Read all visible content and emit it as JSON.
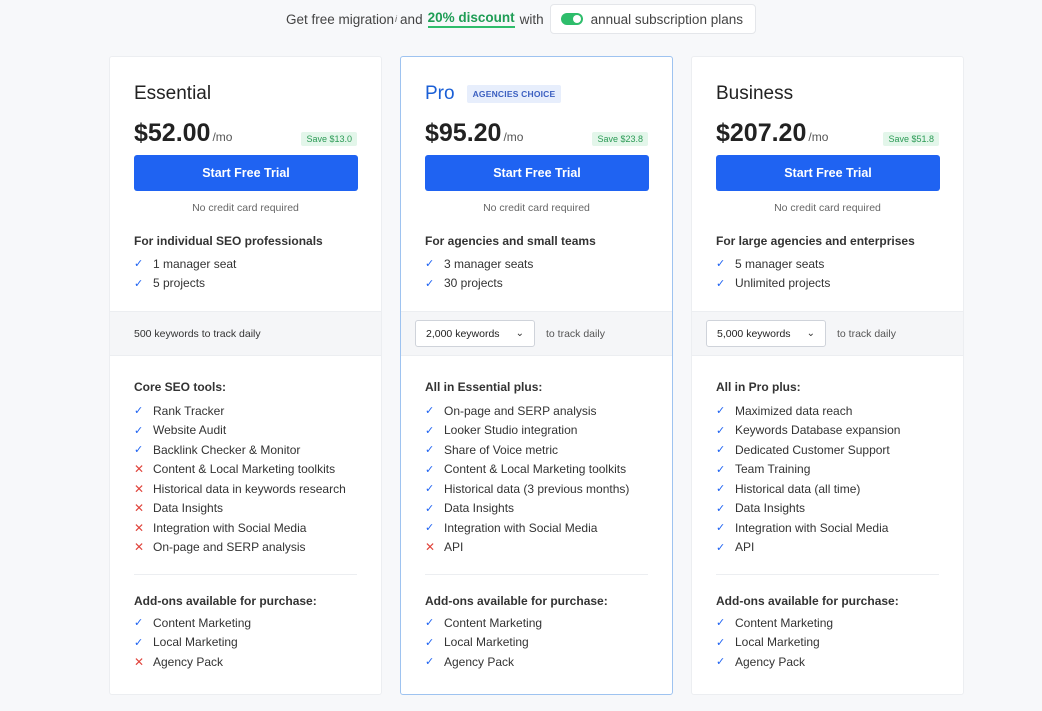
{
  "promo": {
    "text_before": "Get free migration",
    "info_mark": "i",
    "text_and": "and",
    "discount": "20% discount",
    "text_with": "with",
    "toggle_label": "annual subscription plans"
  },
  "colors": {
    "accent": "#1f63f2",
    "check": "#1f63f2",
    "cross": "#e0443c",
    "discount": "#1f9d55"
  },
  "icons": {
    "check": "✓",
    "cross": "✕",
    "chevron": "⌄"
  },
  "plans": [
    {
      "name": "Essential",
      "badge": "",
      "price": "$52.00",
      "period": "/mo",
      "save": "Save $13.0",
      "cta": "Start Free Trial",
      "note": "No credit card required",
      "audience": "For individual SEO professionals",
      "basics": [
        {
          "text": "1 manager seat",
          "included": true
        },
        {
          "text": "5 projects",
          "included": true
        }
      ],
      "keywords_value": "500 keywords to track daily",
      "keywords_suffix": "",
      "features_title": "Core SEO tools:",
      "features": [
        {
          "text": "Rank Tracker",
          "included": true
        },
        {
          "text": "Website Audit",
          "included": true
        },
        {
          "text": "Backlink Checker & Monitor",
          "included": true
        },
        {
          "text": "Content & Local Marketing toolkits",
          "included": false
        },
        {
          "text": "Historical data in keywords research",
          "included": false
        },
        {
          "text": "Data Insights",
          "included": false
        },
        {
          "text": "Integration with Social Media",
          "included": false
        },
        {
          "text": "On-page and SERP analysis",
          "included": false
        }
      ],
      "addons_title": "Add-ons available for purchase:",
      "addons": [
        {
          "text": "Content Marketing",
          "included": true
        },
        {
          "text": "Local Marketing",
          "included": true
        },
        {
          "text": "Agency Pack",
          "included": false
        }
      ]
    },
    {
      "name": "Pro",
      "badge": "AGENCIES CHOICE",
      "price": "$95.20",
      "period": "/mo",
      "save": "Save $23.8",
      "cta": "Start Free Trial",
      "note": "No credit card required",
      "audience": "For agencies and small teams",
      "basics": [
        {
          "text": "3 manager seats",
          "included": true
        },
        {
          "text": "30 projects",
          "included": true
        }
      ],
      "keywords_value": "2,000 keywords",
      "keywords_suffix": "to track daily",
      "features_title": "All in Essential plus:",
      "features": [
        {
          "text": "On-page and SERP analysis",
          "included": true
        },
        {
          "text": "Looker Studio integration",
          "included": true
        },
        {
          "text": "Share of Voice metric",
          "included": true
        },
        {
          "text": "Content & Local Marketing toolkits",
          "included": true
        },
        {
          "text": "Historical data (3 previous months)",
          "included": true
        },
        {
          "text": "Data Insights",
          "included": true
        },
        {
          "text": "Integration with Social Media",
          "included": true
        },
        {
          "text": "API",
          "included": false
        }
      ],
      "addons_title": "Add-ons available for purchase:",
      "addons": [
        {
          "text": "Content Marketing",
          "included": true
        },
        {
          "text": "Local Marketing",
          "included": true
        },
        {
          "text": "Agency Pack",
          "included": true
        }
      ]
    },
    {
      "name": "Business",
      "badge": "",
      "price": "$207.20",
      "period": "/mo",
      "save": "Save $51.8",
      "cta": "Start Free Trial",
      "note": "No credit card required",
      "audience": "For large agencies and enterprises",
      "basics": [
        {
          "text": "5 manager seats",
          "included": true
        },
        {
          "text": "Unlimited projects",
          "included": true
        }
      ],
      "keywords_value": "5,000 keywords",
      "keywords_suffix": "to track daily",
      "features_title": "All in Pro plus:",
      "features": [
        {
          "text": "Maximized data reach",
          "included": true
        },
        {
          "text": "Keywords Database expansion",
          "included": true
        },
        {
          "text": "Dedicated Customer Support",
          "included": true
        },
        {
          "text": "Team Training",
          "included": true
        },
        {
          "text": "Historical data (all time)",
          "included": true
        },
        {
          "text": "Data Insights",
          "included": true
        },
        {
          "text": "Integration with Social Media",
          "included": true
        },
        {
          "text": "API",
          "included": true
        }
      ],
      "addons_title": "Add-ons available for purchase:",
      "addons": [
        {
          "text": "Content Marketing",
          "included": true
        },
        {
          "text": "Local Marketing",
          "included": true
        },
        {
          "text": "Agency Pack",
          "included": true
        }
      ]
    }
  ]
}
